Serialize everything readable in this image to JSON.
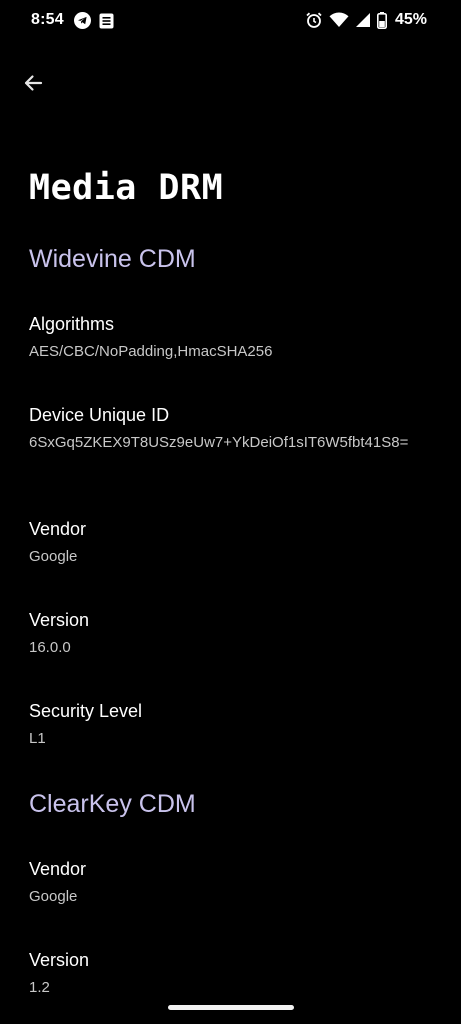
{
  "status_bar": {
    "time": "8:54",
    "battery_percent": "45%",
    "left_icons": [
      "telegram-icon",
      "notes-icon"
    ],
    "right_icons": [
      "alarm-icon",
      "wifi-icon",
      "cellular-signal-icon",
      "battery-icon"
    ]
  },
  "app_bar": {
    "back_icon": "arrow-back-icon"
  },
  "page": {
    "title": "Media DRM"
  },
  "widevine": {
    "header": "Widevine CDM",
    "items": [
      {
        "title": "Algorithms",
        "summary": "AES/CBC/NoPadding,HmacSHA256"
      },
      {
        "title": "Device Unique ID",
        "summary": "6SxGq5ZKEX9T8USz9eUw7+YkDeiOf1sIT6W5fbt41S8="
      },
      {
        "title": "Vendor",
        "summary": "Google"
      },
      {
        "title": "Version",
        "summary": "16.0.0"
      },
      {
        "title": "Security Level",
        "summary": "L1"
      }
    ]
  },
  "clearkey": {
    "header": "ClearKey CDM",
    "items": [
      {
        "title": "Vendor",
        "summary": "Google"
      },
      {
        "title": "Version",
        "summary": "1.2"
      }
    ]
  },
  "colors": {
    "background": "#000000",
    "section_header": "#c9c3ec",
    "summary_text": "#c8c8c8"
  }
}
